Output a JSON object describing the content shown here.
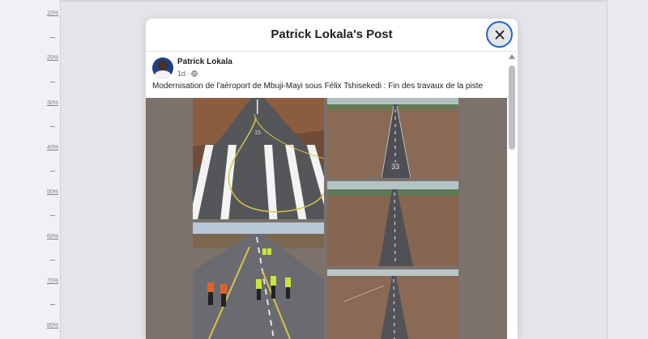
{
  "ruler": {
    "labels": [
      "10%",
      "20%",
      "30%",
      "40%",
      "50%",
      "60%",
      "70%",
      "80%"
    ]
  },
  "modal": {
    "title": "Patrick Lokala's Post",
    "close_icon": "close-icon"
  },
  "post": {
    "author": "Patrick Lokala",
    "time": "1d",
    "separator": "·",
    "privacy_icon": "globe-icon",
    "caption": "Modernisation de l'aéroport de Mbuji-Mayi sous Félix Tshisekedi : Fin des travaux de la piste",
    "photos": [
      {
        "id": "runway-threshold-photo",
        "runway_number": "15"
      },
      {
        "id": "runway-33-photo",
        "runway_number": "33"
      },
      {
        "id": "runway-workers-photo"
      },
      {
        "id": "runway-aerial-photo"
      },
      {
        "id": "runway-far-photo"
      }
    ]
  },
  "colors": {
    "accent": "#1a64d6",
    "media_background": "#7d716c"
  }
}
